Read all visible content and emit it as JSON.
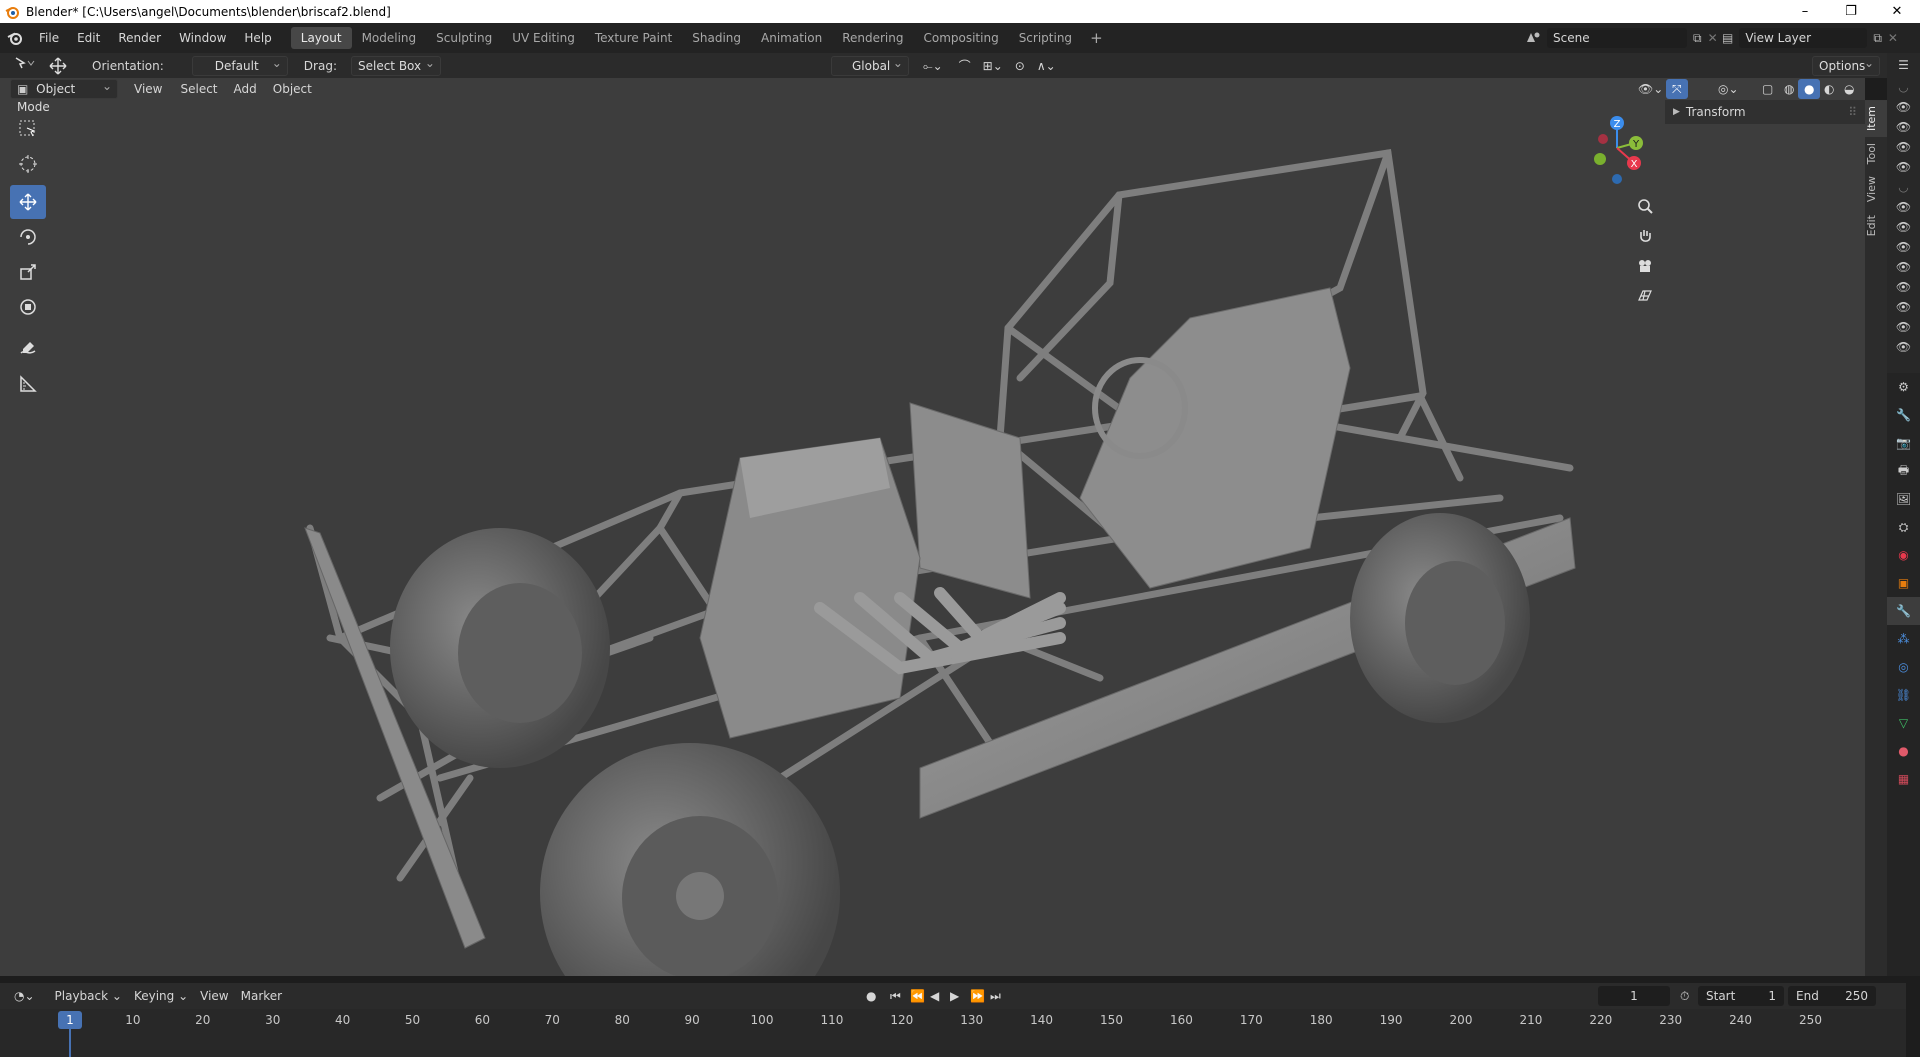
{
  "window": {
    "title": "Blender* [C:\\Users\\angel\\Documents\\blender\\briscaf2.blend]",
    "minimize": "–",
    "restore": "❐",
    "close": "✕"
  },
  "menu": [
    "File",
    "Edit",
    "Render",
    "Window",
    "Help"
  ],
  "workspaces": {
    "tabs": [
      "Layout",
      "Modeling",
      "Sculpting",
      "UV Editing",
      "Texture Paint",
      "Shading",
      "Animation",
      "Rendering",
      "Compositing",
      "Scripting"
    ],
    "active": "Layout",
    "add": "+"
  },
  "scene": {
    "value": "Scene"
  },
  "view_layer": {
    "value": "View Layer"
  },
  "tool_header": {
    "orientation_label": "Orientation:",
    "orientation_value": "Default",
    "drag_label": "Drag:",
    "drag_value": "Select Box",
    "transform_orientation": "Global",
    "options": "Options"
  },
  "view_header": {
    "mode": "Object Mode",
    "items": [
      "View",
      "Select",
      "Add",
      "Object"
    ]
  },
  "npanel": {
    "section": "Transform",
    "tabs": [
      "Item",
      "Tool",
      "View",
      "Edit"
    ],
    "active_tab": "Item"
  },
  "gizmo": {
    "z": "Z",
    "y": "Y",
    "x": "X"
  },
  "timeline": {
    "menus": [
      "Playback",
      "Keying",
      "View",
      "Marker"
    ],
    "current_frame": "1",
    "start_label": "Start",
    "start": "1",
    "end_label": "End",
    "end": "250",
    "ticks": [
      "10",
      "20",
      "30",
      "40",
      "50",
      "60",
      "70",
      "80",
      "90",
      "100",
      "110",
      "120",
      "130",
      "140",
      "150",
      "160",
      "170",
      "180",
      "190",
      "200",
      "210",
      "220",
      "230",
      "240",
      "250"
    ]
  },
  "colors": {
    "accent": "#4772b3",
    "viewport_bg": "#3d3d3d",
    "axis_x": "#e8394d",
    "axis_y": "#8bbd3a",
    "axis_z": "#3b8ded"
  }
}
